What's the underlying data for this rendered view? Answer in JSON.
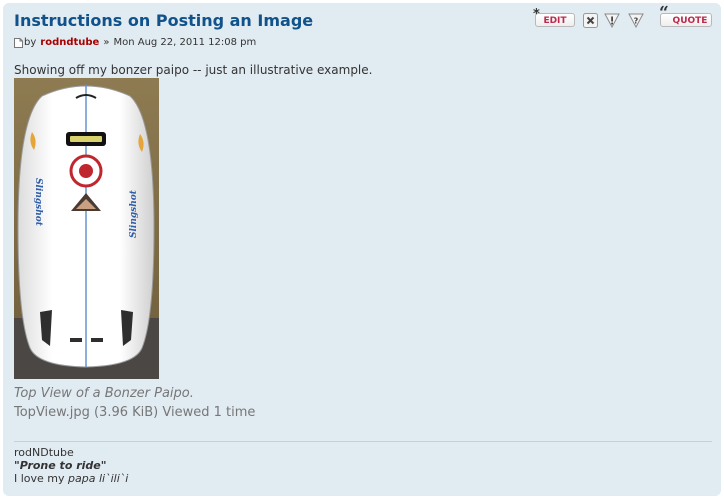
{
  "post": {
    "title": "Instructions on Posting an Image",
    "by_label": "by",
    "author": "rodndtube",
    "separator": "»",
    "date": "Mon Aug 22, 2011 12:08 pm",
    "content": "Showing off my bonzer paipo -- just an illustrative example."
  },
  "buttons": {
    "edit": "EDIT",
    "quote": "QUOTE",
    "edit_star": "*",
    "quote_mark": "“"
  },
  "attachment": {
    "caption": "Top View of a Bonzer Paipo.",
    "meta": "TopView.jpg (3.96 KiB) Viewed 1 time",
    "image_label": "Slingshot"
  },
  "signature": {
    "name": "rodNDtube",
    "motto": "\"Prone to ride\"",
    "line_prefix": "I love my ",
    "line_italic": "papa li`ili`i"
  },
  "colors": {
    "title": "#105289",
    "author": "#aa0000",
    "button_text": "#bc2a4d",
    "post_bg": "#e1ebf2",
    "muted_text": "#777777"
  }
}
